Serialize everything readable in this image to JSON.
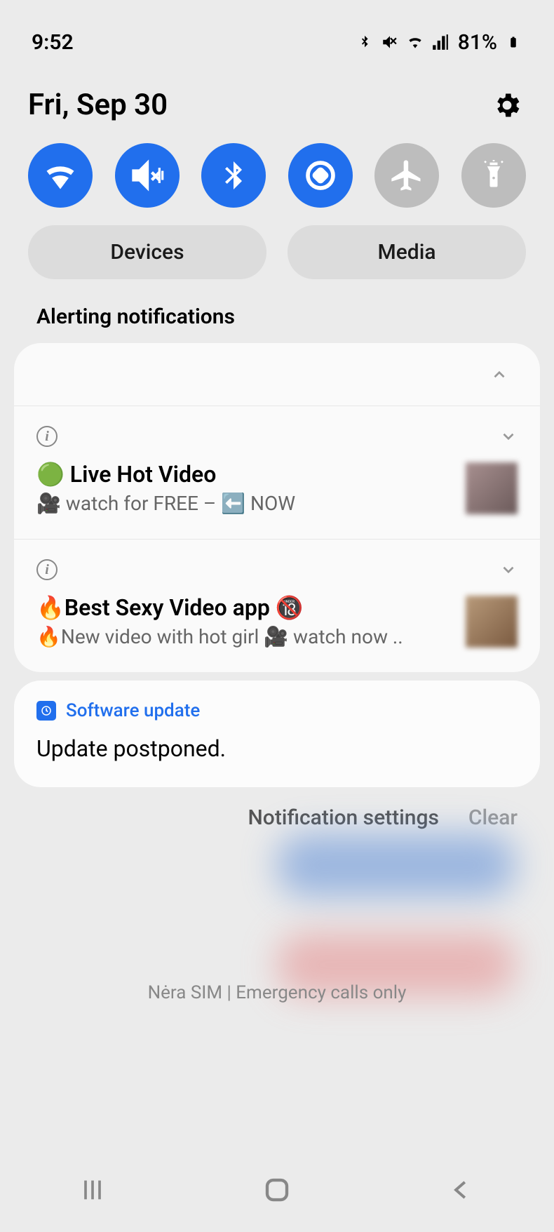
{
  "statusbar": {
    "time": "9:52",
    "battery": "81%"
  },
  "header": {
    "date": "Fri, Sep 30"
  },
  "panels": {
    "devices": "Devices",
    "media": "Media"
  },
  "section_label": "Alerting notifications",
  "notifications": [
    {
      "title": "🟢 Live Hot Video",
      "subtitle": "🎥 watch for FREE – ⬅️ NOW"
    },
    {
      "title": "🔥Best Sexy Video app 🔞",
      "subtitle": "🔥New video with hot girl 🎥 watch now .."
    }
  ],
  "update": {
    "app_name": "Software update",
    "title": "Update postponed."
  },
  "footer": {
    "settings": "Notification settings",
    "clear": "Clear"
  },
  "sim_text": "Nėra SIM | Emergency calls only"
}
